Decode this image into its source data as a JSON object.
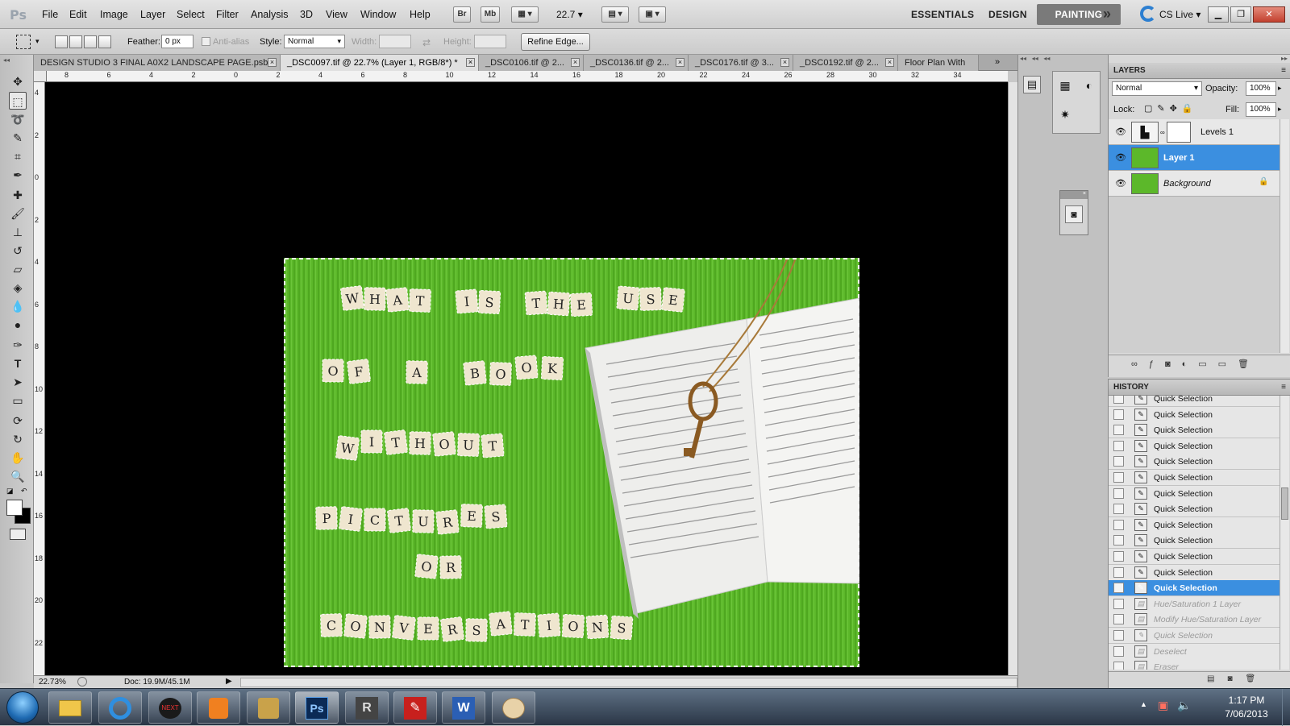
{
  "app": {
    "logo": "Ps"
  },
  "menubar": {
    "items": [
      "File",
      "Edit",
      "Image",
      "Layer",
      "Select",
      "Filter",
      "Analysis",
      "3D",
      "View",
      "Window",
      "Help"
    ],
    "bridge_label": "Br",
    "minibridge_label": "Mb",
    "zoom_value": "22.7",
    "workspaces": [
      "ESSENTIALS",
      "DESIGN",
      "PAINTING"
    ],
    "more_label": "»",
    "cs_live_label": "CS Live"
  },
  "options": {
    "feather_label": "Feather:",
    "feather_value": "0 px",
    "antialias_label": "Anti-alias",
    "style_label": "Style:",
    "style_value": "Normal",
    "width_label": "Width:",
    "height_label": "Height:",
    "refine_edge_label": "Refine Edge..."
  },
  "tabs": [
    {
      "label": "DESIGN STUDIO 3 FINAL A0X2 LANDSCAPE PAGE.psb",
      "active": false
    },
    {
      "label": "_DSC0097.tif @ 22.7% (Layer 1, RGB/8*) *",
      "active": true
    },
    {
      "label": "_DSC0106.tif @ 2...",
      "active": false
    },
    {
      "label": "_DSC0136.tif @ 2...",
      "active": false
    },
    {
      "label": "_DSC0176.tif @ 3...",
      "active": false
    },
    {
      "label": "_DSC0192.tif @ 2...",
      "active": false
    },
    {
      "label": "Floor Plan With",
      "active": false
    }
  ],
  "ruler_top": [
    "8",
    "6",
    "4",
    "2",
    "0",
    "2",
    "4",
    "6",
    "8",
    "10",
    "12",
    "14",
    "16",
    "18",
    "20",
    "22",
    "24",
    "26",
    "28",
    "30",
    "32",
    "34"
  ],
  "ruler_left": [
    "4",
    "2",
    "0",
    "2",
    "4",
    "6",
    "8",
    "10",
    "12",
    "14",
    "16",
    "18",
    "20",
    "22"
  ],
  "image": {
    "text_lines": [
      "WHAT IS THE USE",
      "OF A BOOK",
      "WITHOUT",
      "PICTURES",
      "OR",
      "CONVERSATIONS"
    ],
    "colors": {
      "mat": "#5cb82a",
      "tile": "#efe6cf"
    }
  },
  "status": {
    "zoom": "22.73%",
    "doc": "Doc: 19.9M/45.1M"
  },
  "layers": {
    "title": "LAYERS",
    "blend_mode": "Normal",
    "opacity_label": "Opacity:",
    "opacity_value": "100%",
    "lock_label": "Lock:",
    "fill_label": "Fill:",
    "fill_value": "100%",
    "items": [
      {
        "name": "Levels 1",
        "selected": false
      },
      {
        "name": "Layer 1",
        "selected": true
      },
      {
        "name": "Background",
        "selected": false
      }
    ]
  },
  "history": {
    "title": "HISTORY",
    "items": [
      {
        "label": "Quick Selection",
        "state": "normal"
      },
      {
        "label": "Quick Selection",
        "state": "normal"
      },
      {
        "label": "Quick Selection",
        "state": "normal"
      },
      {
        "label": "Quick Selection",
        "state": "normal"
      },
      {
        "label": "Quick Selection",
        "state": "normal"
      },
      {
        "label": "Quick Selection",
        "state": "normal"
      },
      {
        "label": "Quick Selection",
        "state": "normal"
      },
      {
        "label": "Quick Selection",
        "state": "normal"
      },
      {
        "label": "Quick Selection",
        "state": "normal"
      },
      {
        "label": "Quick Selection",
        "state": "normal"
      },
      {
        "label": "Quick Selection",
        "state": "normal"
      },
      {
        "label": "Quick Selection",
        "state": "normal"
      },
      {
        "label": "Quick Selection",
        "state": "selected"
      },
      {
        "label": "Hue/Saturation 1 Layer",
        "state": "faded"
      },
      {
        "label": "Modify Hue/Saturation Layer",
        "state": "faded"
      },
      {
        "label": "Quick Selection",
        "state": "faded"
      },
      {
        "label": "Deselect",
        "state": "faded"
      },
      {
        "label": "Eraser",
        "state": "faded"
      }
    ]
  },
  "taskbar": {
    "time": "1:17 PM",
    "date": "7/06/2013"
  }
}
